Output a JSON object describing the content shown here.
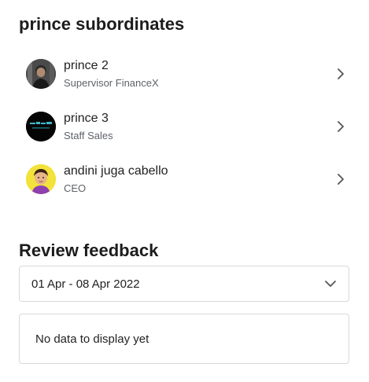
{
  "subordinates": {
    "title": "prince subordinates",
    "items": [
      {
        "name": "prince 2",
        "role": "Supervisor FinanceX",
        "avatar_icon": "person-photo-icon"
      },
      {
        "name": "prince 3",
        "role": "Staff Sales",
        "avatar_icon": "dark-logo-icon"
      },
      {
        "name": "andini juga cabello",
        "role": "CEO",
        "avatar_icon": "cartoon-person-icon"
      }
    ]
  },
  "review": {
    "title": "Review feedback",
    "period_selected": "01 Apr - 08 Apr 2022",
    "empty_message": "No data to display yet"
  },
  "colors": {
    "text_primary": "#222222",
    "text_secondary": "#5f6368",
    "border": "#d9d9d9"
  }
}
